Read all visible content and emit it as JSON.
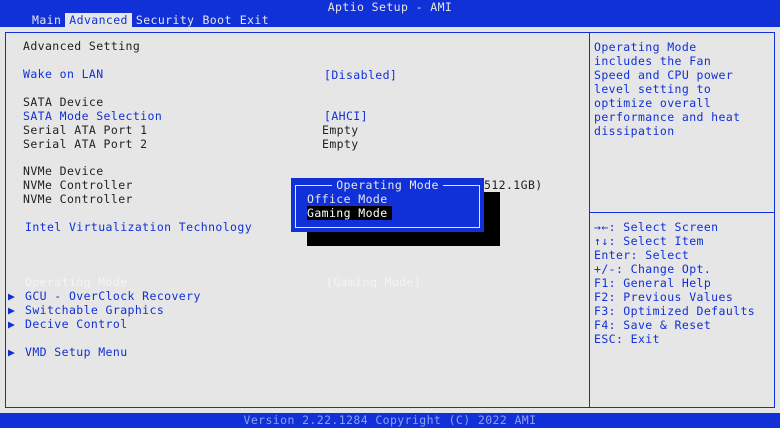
{
  "title": "Aptio Setup - AMI",
  "menu": {
    "tabs": [
      "Main",
      "Advanced",
      "Security",
      "Boot",
      "Exit"
    ],
    "active_tab": "Advanced"
  },
  "left": {
    "heading": "Advanced Setting",
    "wake_on_lan": {
      "label": "Wake on LAN",
      "value": "[Disabled]"
    },
    "sata_device": "SATA Device",
    "sata_mode": {
      "label": "SATA Mode Selection",
      "value": "[AHCI]"
    },
    "sata_port1": {
      "label": "Serial ATA Port 1",
      "value": "Empty"
    },
    "sata_port2": {
      "label": "Serial ATA Port 2",
      "value": "Empty"
    },
    "nvme_device": "NVMe Device",
    "nvme_controller1": {
      "label": "NVMe Controller",
      "value_partial": "512.1GB)"
    },
    "nvme_controller2": {
      "label": "NVMe Controller"
    },
    "intel_vt": {
      "label": "Intel Virtualization Technology"
    },
    "operating_mode": {
      "label": "Operating Mode",
      "value": "[Gaming Mode]"
    },
    "submenus": [
      {
        "label": "GCU - OverClock Recovery"
      },
      {
        "label": "Switchable Graphics"
      },
      {
        "label": "Decive Control"
      },
      {
        "label": "VMD Setup Menu"
      }
    ],
    "submenu_arrow": "▶"
  },
  "popup": {
    "title": "Operating Mode",
    "options": [
      "Office Mode",
      "Gaming Mode"
    ],
    "selected": "Gaming Mode"
  },
  "help": {
    "description_lines": [
      "Operating Mode",
      "includes the Fan",
      "Speed and CPU power",
      "level setting to",
      "optimize overall",
      "performance and heat",
      "dissipation"
    ],
    "keys": [
      "→←: Select Screen",
      "↑↓: Select Item",
      "Enter: Select",
      "+/-: Change Opt.",
      "F1: General Help",
      "F2: Previous Values",
      "F3: Optimized Defaults",
      "F4: Save & Reset",
      "ESC: Exit"
    ]
  },
  "footer": "Version 2.22.1284 Copyright (C) 2022 AMI",
  "colors": {
    "accent": "#1030d8",
    "background": "#e6e6e6",
    "highlight": "#f4f4f4"
  }
}
